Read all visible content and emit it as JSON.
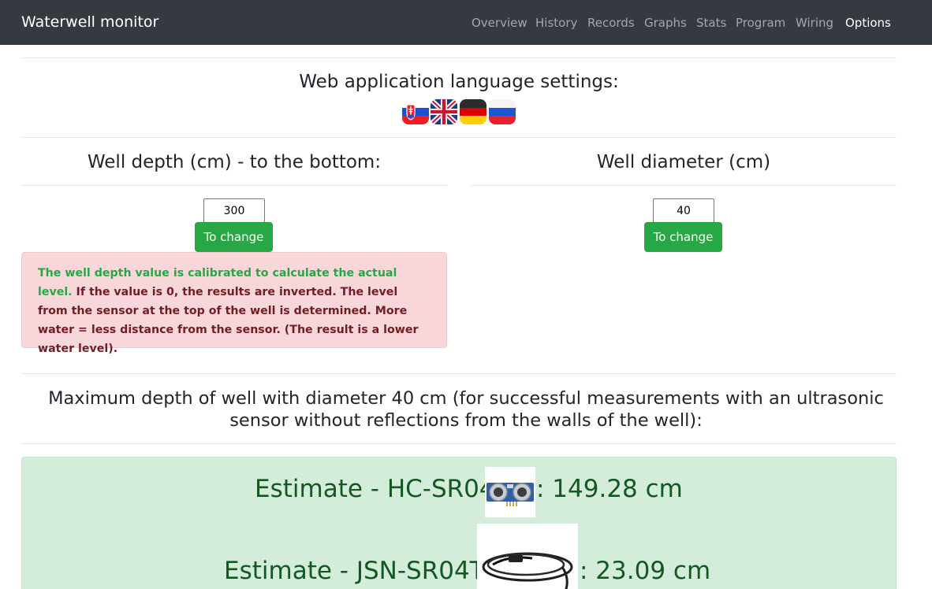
{
  "nav": {
    "brand": "Waterwell monitor",
    "links": [
      "Overview",
      "History",
      "Records",
      "Graphs",
      "Stats",
      "Program",
      "Wiring",
      "Options"
    ],
    "active": "Options"
  },
  "language": {
    "title": "Web application language settings:",
    "flags": [
      "slovakia-flag-icon",
      "uk-flag-icon",
      "germany-flag-icon",
      "russia-flag-icon"
    ]
  },
  "depth": {
    "title": "Well depth (cm) - to the bottom:",
    "value": "300",
    "button": "To change",
    "note_green": "The well depth value is calibrated to calculate the actual level.",
    "note_rest": " If the value is 0, the results are inverted. The level from the sensor at the top of the well is determined. More water = less distance from the sensor. (The result is a lower water level)."
  },
  "diameter": {
    "title": "Well diameter (cm)",
    "value": "40",
    "button": "To change"
  },
  "max_depth_heading": "Maximum depth of well with diameter 40 cm (for successful measurements with an ultrasonic sensor without reflections from the walls of the well):",
  "estimates": [
    {
      "prefix": "Estimate - HC-SR04",
      "value": ": 149.28 cm",
      "image": "hc-sr04-sensor-image"
    },
    {
      "prefix": "Estimate - JSN-SR04T",
      "value": ": 23.09 cm",
      "image": "jsn-sr04t-sensor-image"
    }
  ],
  "colors": {
    "navbar": "#343a40",
    "success_button": "#28a745",
    "danger_bg": "#f8d7da",
    "danger_text": "#721c24",
    "success_bg": "#d4edda",
    "success_text": "#155724"
  }
}
